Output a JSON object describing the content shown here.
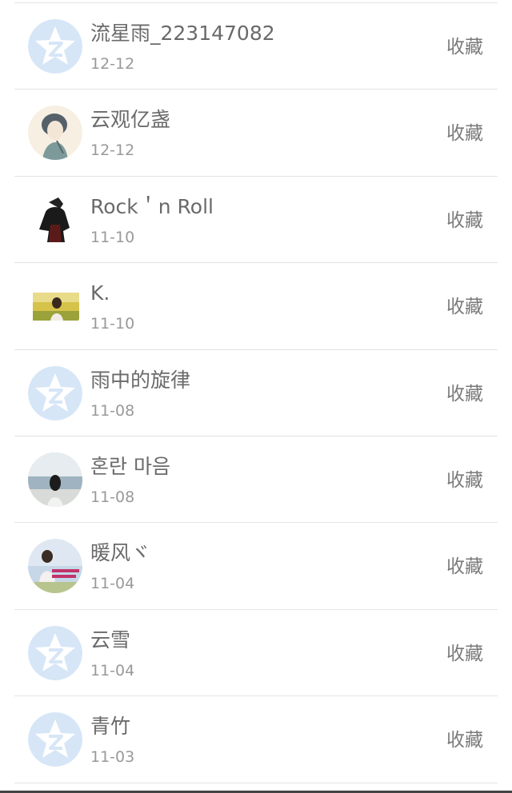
{
  "list": {
    "items": [
      {
        "name": "流星雨_223147082",
        "date": "12-12",
        "action": "收藏",
        "avatar": "default-qq-star-icon"
      },
      {
        "name": "云观亿盏",
        "date": "12-12",
        "action": "收藏",
        "avatar": "sketch-portrait-avatar"
      },
      {
        "name": "Rock＇n Roll",
        "date": "11-10",
        "action": "收藏",
        "avatar": "dark-cloaked-figure-avatar"
      },
      {
        "name": "K.",
        "date": "11-10",
        "action": "收藏",
        "avatar": "girl-in-field-photo-avatar"
      },
      {
        "name": "雨中的旋律",
        "date": "11-08",
        "action": "收藏",
        "avatar": "default-qq-star-icon"
      },
      {
        "name": "혼란 마음",
        "date": "11-08",
        "action": "收藏",
        "avatar": "girl-by-sea-photo-avatar"
      },
      {
        "name": "暖风ヾ",
        "date": "11-04",
        "action": "收藏",
        "avatar": "girl-with-text-banner-avatar"
      },
      {
        "name": "云雪",
        "date": "11-04",
        "action": "收藏",
        "avatar": "default-qq-star-icon"
      },
      {
        "name": "青竹",
        "date": "11-03",
        "action": "收藏",
        "avatar": "default-qq-star-icon"
      }
    ]
  },
  "colors": {
    "divider": "#e3e3e3",
    "name_text": "#6a6a6a",
    "date_text": "#999999",
    "action_text": "#7a7a7a",
    "default_avatar_bg": "#d6e6f7",
    "default_avatar_star": "#ffffff"
  }
}
